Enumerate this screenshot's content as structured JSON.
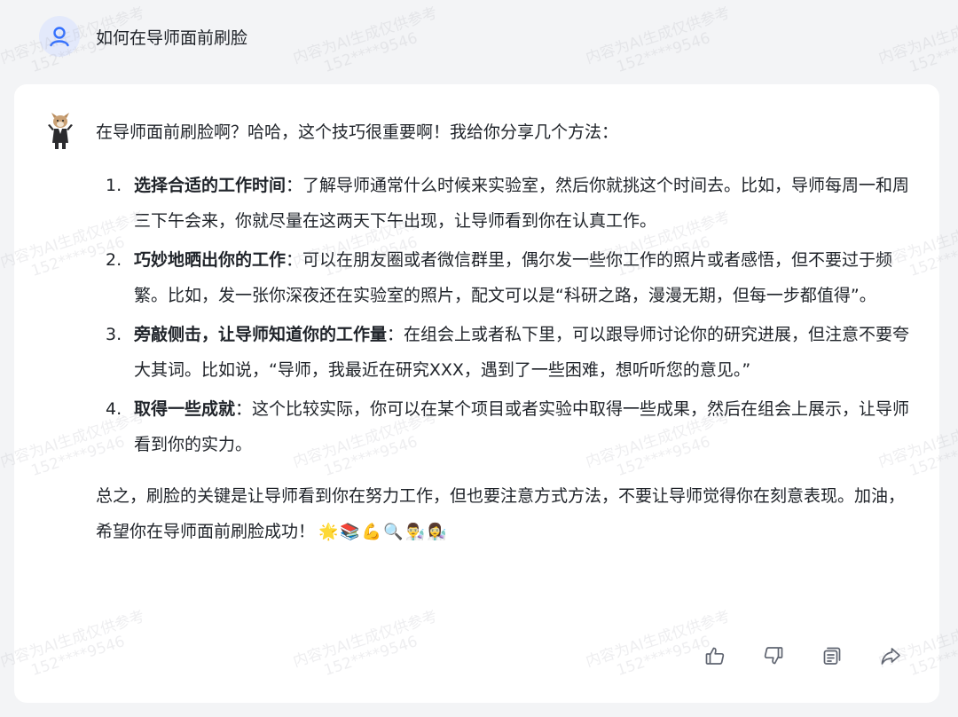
{
  "user": {
    "question": "如何在导师面前刷脸"
  },
  "answer": {
    "intro": "在导师面前刷脸啊？哈哈，这个技巧很重要啊！我给你分享几个方法：",
    "items": [
      {
        "num": "1.",
        "title": "选择合适的工作时间",
        "text": "：了解导师通常什么时候来实验室，然后你就挑这个时间去。比如，导师每周一和周三下午会来，你就尽量在这两天下午出现，让导师看到你在认真工作。"
      },
      {
        "num": "2.",
        "title": "巧妙地晒出你的工作",
        "text": "：可以在朋友圈或者微信群里，偶尔发一些你工作的照片或者感悟，但不要过于频繁。比如，发一张你深夜还在实验室的照片，配文可以是“科研之路，漫漫无期，但每一步都值得”。"
      },
      {
        "num": "3.",
        "title": "旁敲侧击，让导师知道你的工作量",
        "text": "：在组会上或者私下里，可以跟导师讨论你的研究进展，但注意不要夸大其词。比如说，“导师，我最近在研究XXX，遇到了一些困难，想听听您的意见。”"
      },
      {
        "num": "4.",
        "title": "取得一些成就",
        "text": "：这个比较实际，你可以在某个项目或者实验中取得一些成果，然后在组会上展示，让导师看到你的实力。"
      }
    ],
    "summary": "总之，刷脸的关键是让导师看到你在努力工作，但也要注意方式方法，不要让导师觉得你在刻意表现。加油，希望你在导师面前刷脸成功！",
    "emojis": "🌟📚💪🔍👨‍🔬👩‍🔬"
  },
  "watermark": {
    "line1": "内容为AI生成仅供参考",
    "line2": "152****9546"
  },
  "icons": {
    "user": "user-icon",
    "like": "thumbs-up-icon",
    "dislike": "thumbs-down-icon",
    "copy": "copy-icon",
    "share": "share-icon"
  },
  "colors": {
    "accent": "#3370ff",
    "background": "#f3f4f6",
    "card": "#ffffff"
  }
}
